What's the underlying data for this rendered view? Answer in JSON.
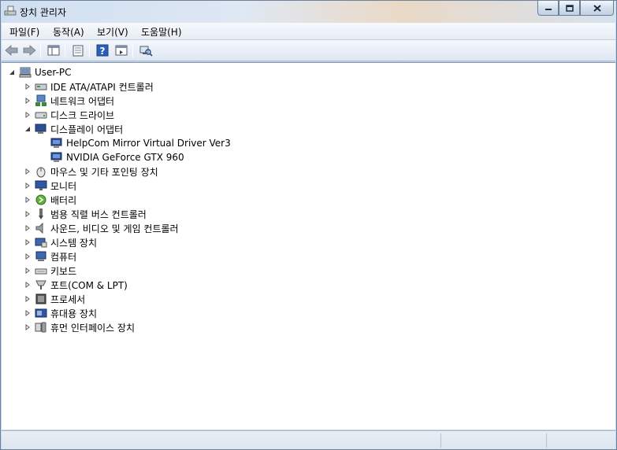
{
  "window": {
    "title": "장치 관리자"
  },
  "menu": [
    {
      "label": "파일(F)"
    },
    {
      "label": "동작(A)"
    },
    {
      "label": "보기(V)"
    },
    {
      "label": "도움말(H)"
    }
  ],
  "tree": {
    "root": "User-PC",
    "items": [
      {
        "label": "IDE ATA/ATAPI 컨트롤러",
        "icon": "ide-controller-icon"
      },
      {
        "label": "네트워크 어댑터",
        "icon": "network-adapter-icon"
      },
      {
        "label": "디스크 드라이브",
        "icon": "disk-drive-icon"
      },
      {
        "label": "디스플레이 어댑터",
        "icon": "display-adapter-icon",
        "expanded": true,
        "children": [
          {
            "label": "HelpCom Mirror Virtual Driver Ver3"
          },
          {
            "label": "NVIDIA GeForce GTX 960"
          }
        ]
      },
      {
        "label": "마우스 및 기타 포인팅 장치",
        "icon": "mouse-icon"
      },
      {
        "label": "모니터",
        "icon": "monitor-icon"
      },
      {
        "label": "배터리",
        "icon": "battery-icon"
      },
      {
        "label": "범용 직렬 버스 컨트롤러",
        "icon": "usb-controller-icon"
      },
      {
        "label": "사운드, 비디오 및 게임 컨트롤러",
        "icon": "sound-icon"
      },
      {
        "label": "시스템 장치",
        "icon": "system-device-icon"
      },
      {
        "label": "컴퓨터",
        "icon": "computer-icon"
      },
      {
        "label": "키보드",
        "icon": "keyboard-icon"
      },
      {
        "label": "포트(COM & LPT)",
        "icon": "port-icon"
      },
      {
        "label": "프로세서",
        "icon": "processor-icon"
      },
      {
        "label": "휴대용 장치",
        "icon": "portable-device-icon"
      },
      {
        "label": "휴먼 인터페이스 장치",
        "icon": "hid-icon"
      }
    ]
  }
}
